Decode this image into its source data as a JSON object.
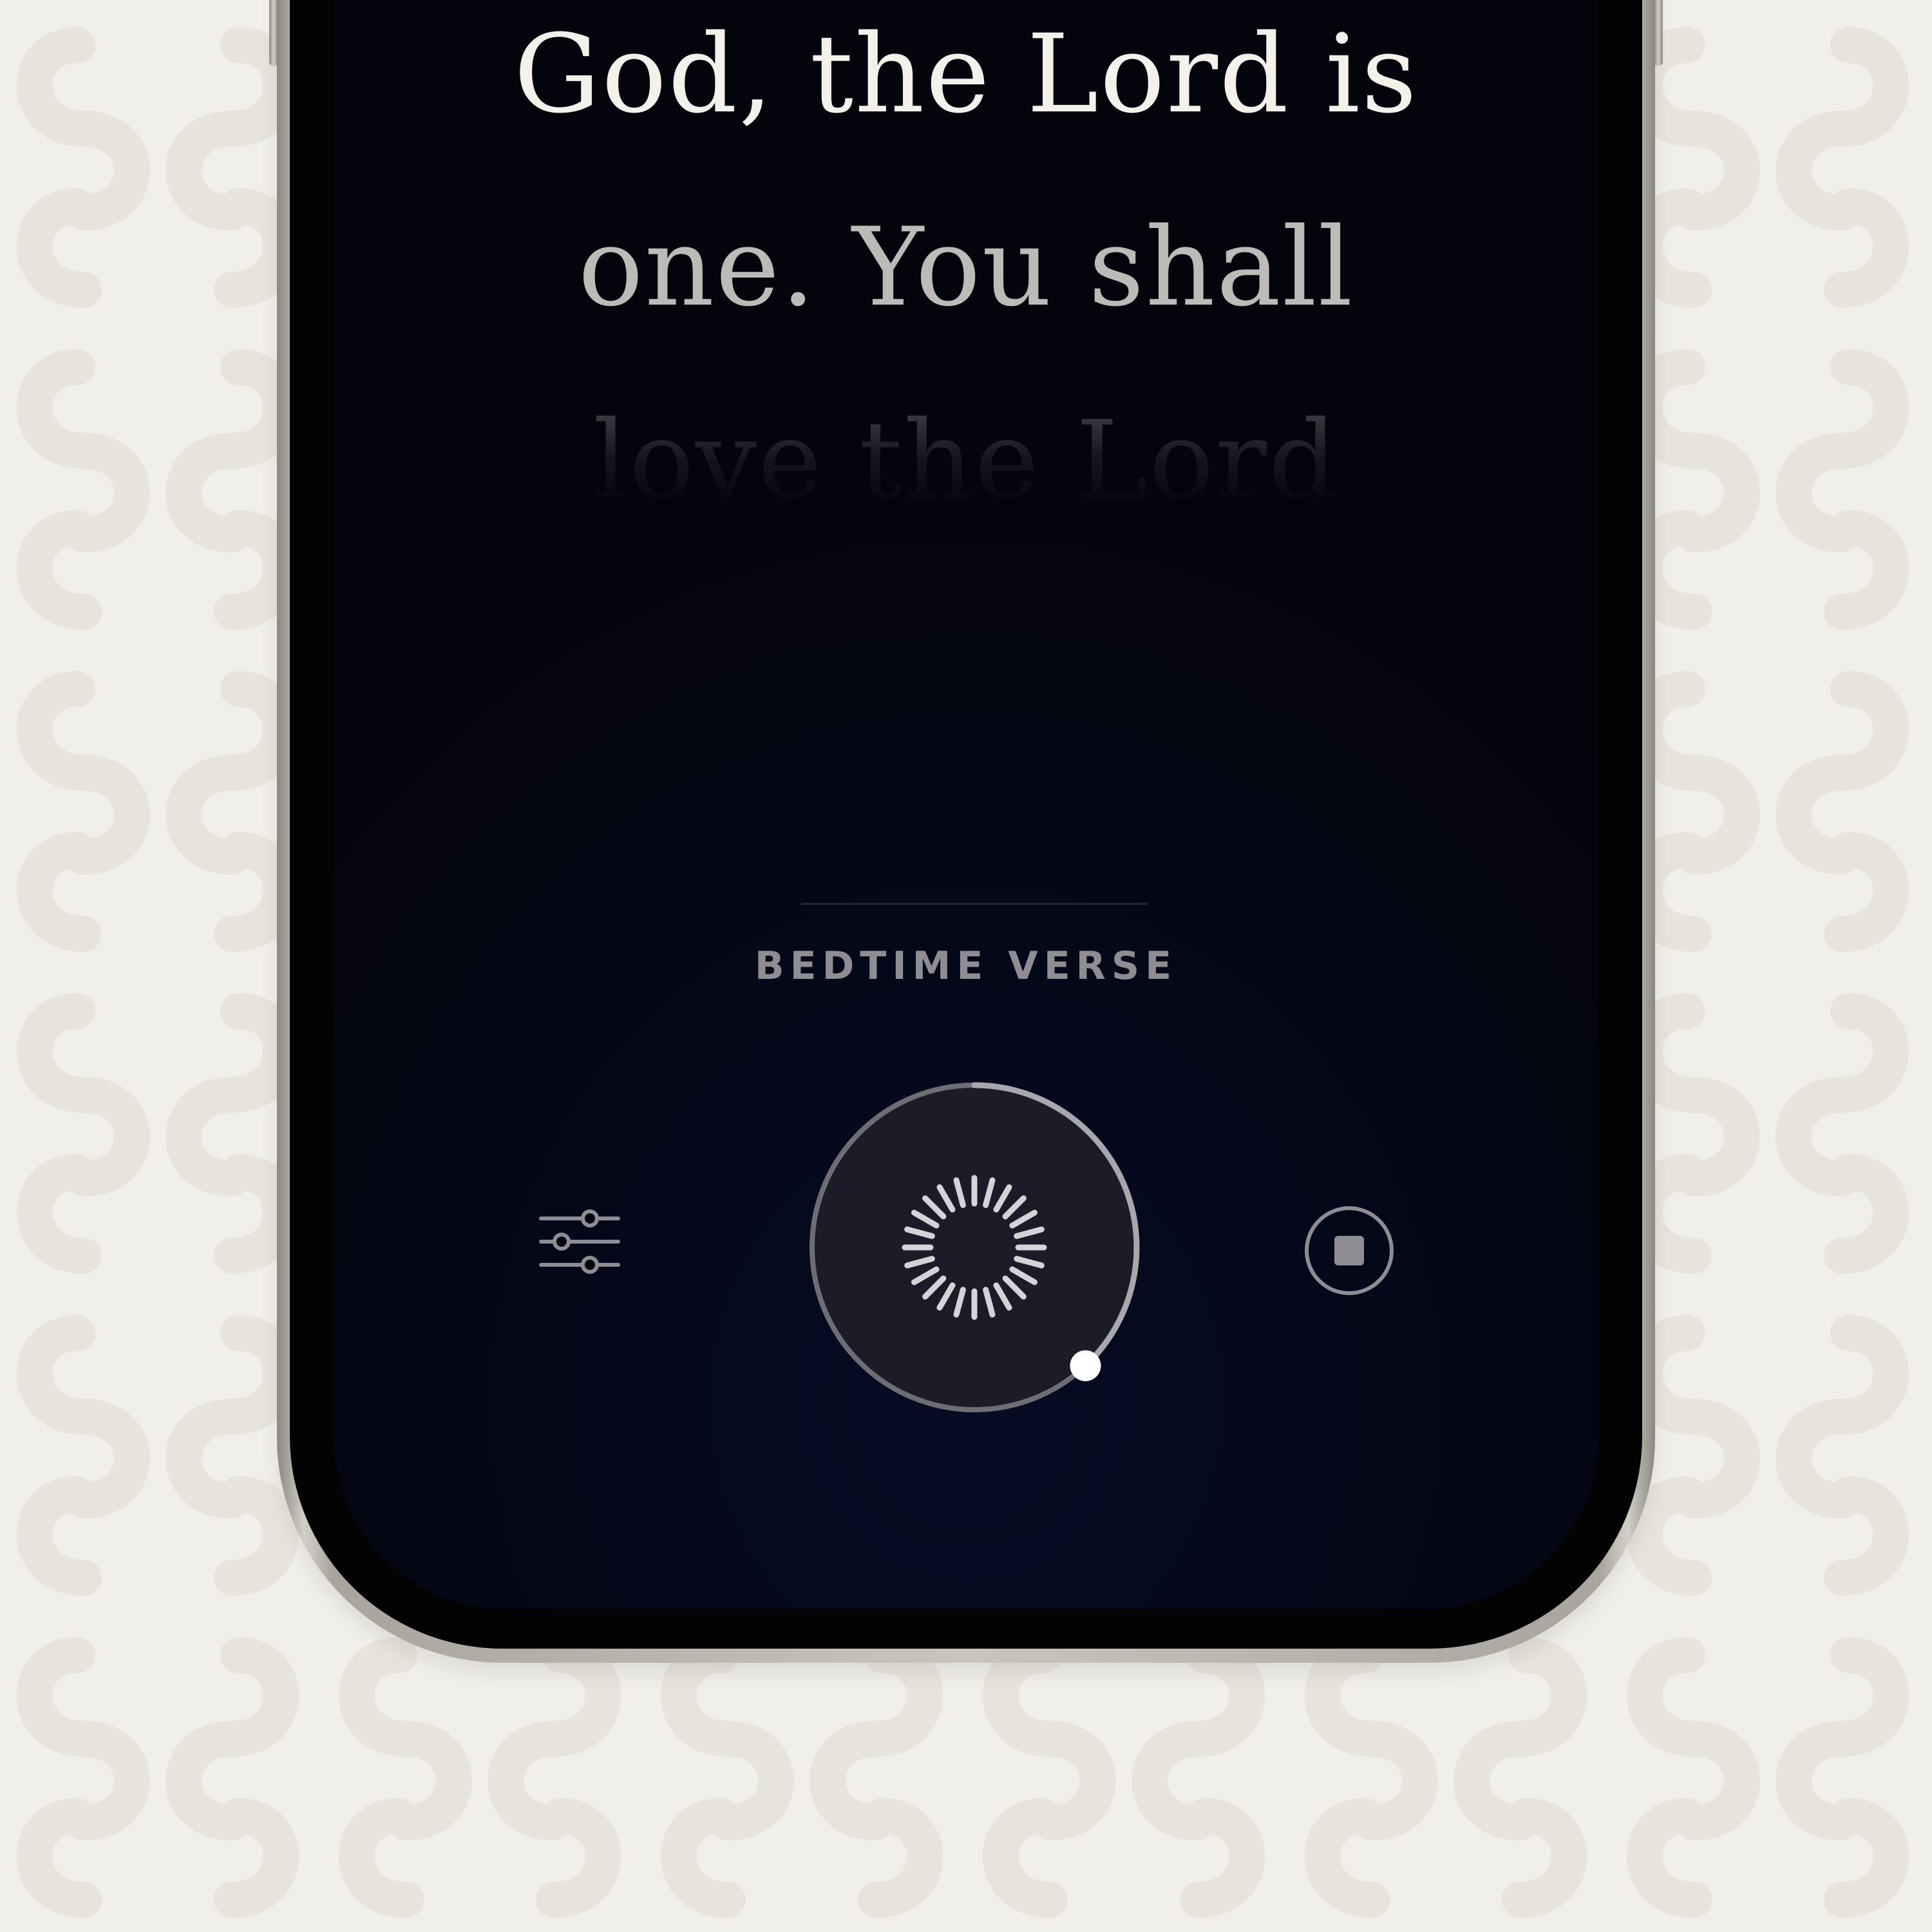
{
  "verse": {
    "lines": [
      "God, the Lord is",
      "one. You shall",
      "love the Lord"
    ]
  },
  "section": {
    "label": "BEDTIME VERSE"
  },
  "player": {
    "progress": 0.38,
    "state": "playing"
  },
  "icons": {
    "settings": "sliders-icon",
    "play": "sunburst-loading-icon",
    "stop": "stop-icon"
  },
  "colors": {
    "background": "#f1efea",
    "screen": "#03040c",
    "verse_text": "#f4f1ea",
    "label_text": "#8e8d92",
    "button_fill": "#1c1c28",
    "ring": "#77767c",
    "knob": "#ffffff"
  }
}
